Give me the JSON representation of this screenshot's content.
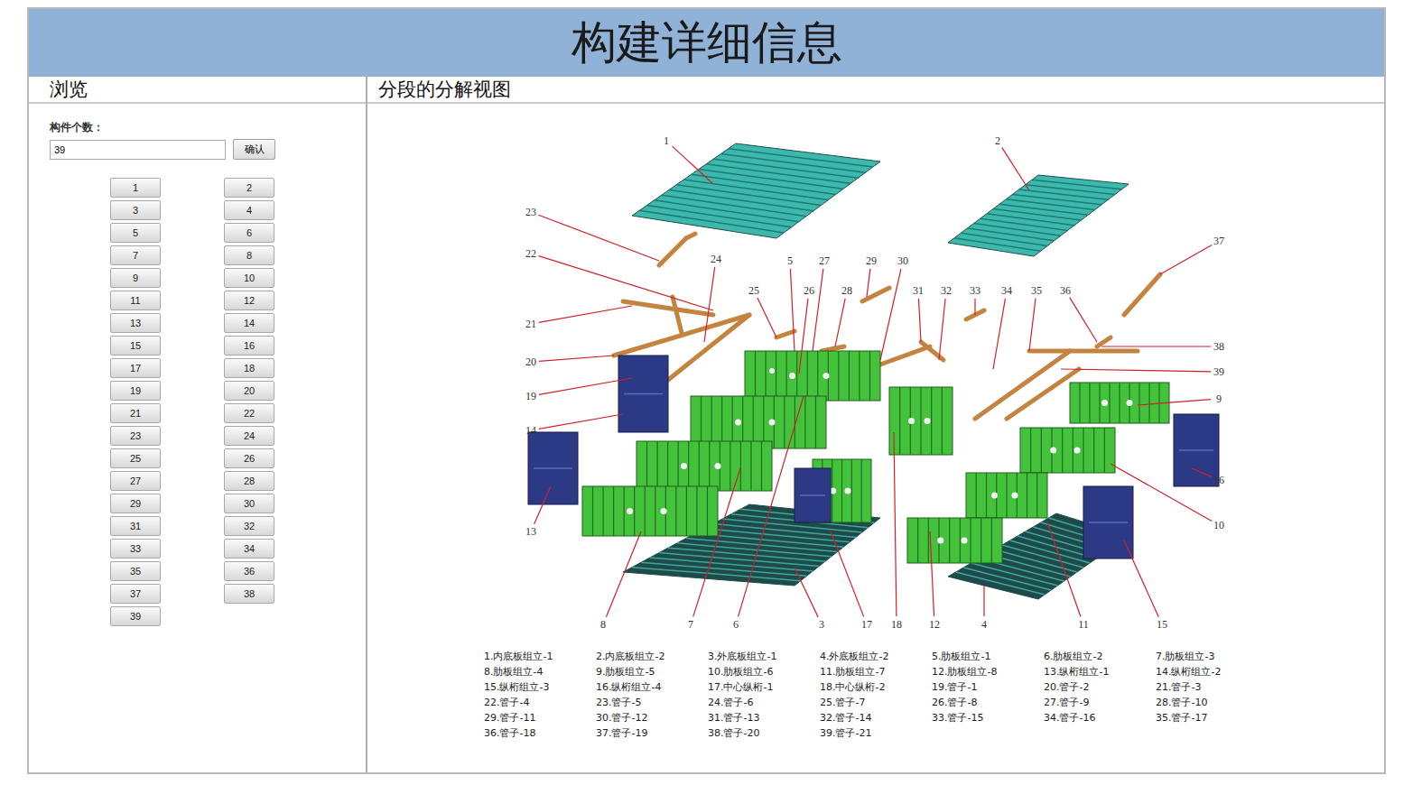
{
  "header": {
    "title": "构建详细信息"
  },
  "browse_panel": {
    "title": "浏览",
    "count_label": "构件个数：",
    "count_value": "39",
    "confirm_button": "确认",
    "part_buttons": [
      "1",
      "2",
      "3",
      "4",
      "5",
      "6",
      "7",
      "8",
      "9",
      "10",
      "11",
      "12",
      "13",
      "14",
      "15",
      "16",
      "17",
      "18",
      "19",
      "20",
      "21",
      "22",
      "23",
      "24",
      "25",
      "26",
      "27",
      "28",
      "29",
      "30",
      "31",
      "32",
      "33",
      "34",
      "35",
      "36",
      "37",
      "38",
      "39"
    ]
  },
  "view_panel": {
    "title": "分段的分解视图",
    "callouts": [
      "1",
      "2",
      "23",
      "22",
      "37",
      "24",
      "5",
      "27",
      "29",
      "30",
      "25",
      "26",
      "28",
      "31",
      "32",
      "33",
      "34",
      "35",
      "36",
      "21",
      "38",
      "20",
      "39",
      "9",
      "19",
      "14",
      "16",
      "13",
      "10",
      "8",
      "7",
      "6",
      "3",
      "17",
      "18",
      "12",
      "4",
      "11",
      "15"
    ],
    "legend": [
      "1.内底板组立-1",
      "2.内底板组立-2",
      "3.外底板组立-1",
      "4.外底板组立-2",
      "5.肋板组立-1",
      "6.肋板组立-2",
      "7.肋板组立-3",
      "8.肋板组立-4",
      "9.肋板组立-5",
      "10.肋板组立-6",
      "11.肋板组立-7",
      "12.肋板组立-8",
      "13.纵桁组立-1",
      "14.纵桁组立-2",
      "15.纵桁组立-3",
      "16.纵桁组立-4",
      "17.中心纵桁-1",
      "18.中心纵桁-2",
      "19.管子-1",
      "20.管子-2",
      "21.管子-3",
      "22.管子-4",
      "23.管子-5",
      "24.管子-6",
      "25.管子-7",
      "26.管子-8",
      "27.管子-9",
      "28.管子-10",
      "29.管子-11",
      "30.管子-12",
      "31.管子-13",
      "32.管子-14",
      "33.管子-15",
      "34.管子-16",
      "35.管子-17",
      "36.管子-18",
      "37.管子-19",
      "38.管子-20",
      "39.管子-21"
    ]
  }
}
